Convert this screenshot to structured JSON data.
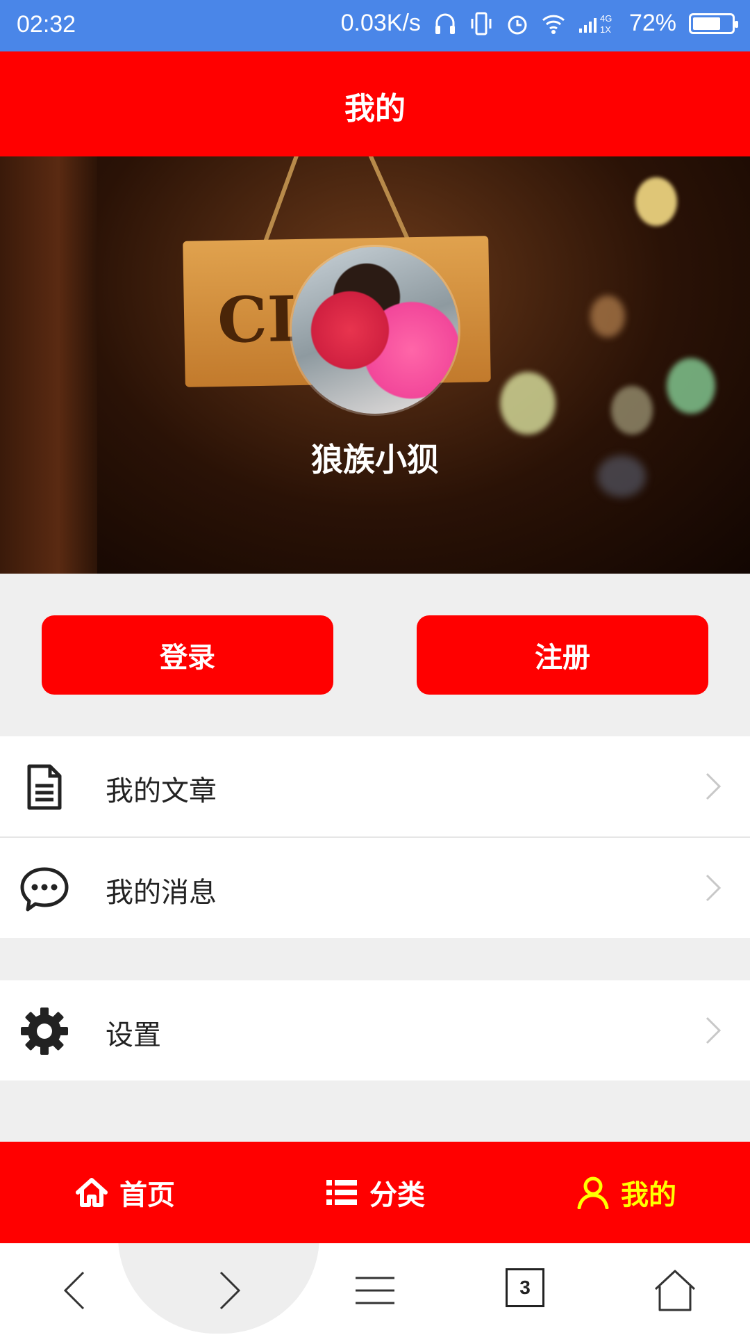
{
  "status_bar": {
    "time": "02:32",
    "net_speed": "0.03K/s",
    "network_label_top": "4G",
    "network_label_bottom": "1X",
    "battery_percent": "72%",
    "battery_level": 0.72
  },
  "header": {
    "title": "我的"
  },
  "profile": {
    "username": "狼族小狈",
    "sign_text": "CL"
  },
  "actions": {
    "login_label": "登录",
    "register_label": "注册"
  },
  "menu": {
    "articles_label": "我的文章",
    "messages_label": "我的消息",
    "settings_label": "设置"
  },
  "tabbar": {
    "items": [
      {
        "label": "首页",
        "icon": "home-icon",
        "active": false
      },
      {
        "label": "分类",
        "icon": "list-icon",
        "active": false
      },
      {
        "label": "我的",
        "icon": "user-icon",
        "active": true
      }
    ],
    "active_color": "#ffff00",
    "bar_color": "#ff0000"
  },
  "browser_nav": {
    "tabs_count": "3"
  },
  "colors": {
    "accent": "#ff0000",
    "status_bar": "#4a86e8"
  }
}
